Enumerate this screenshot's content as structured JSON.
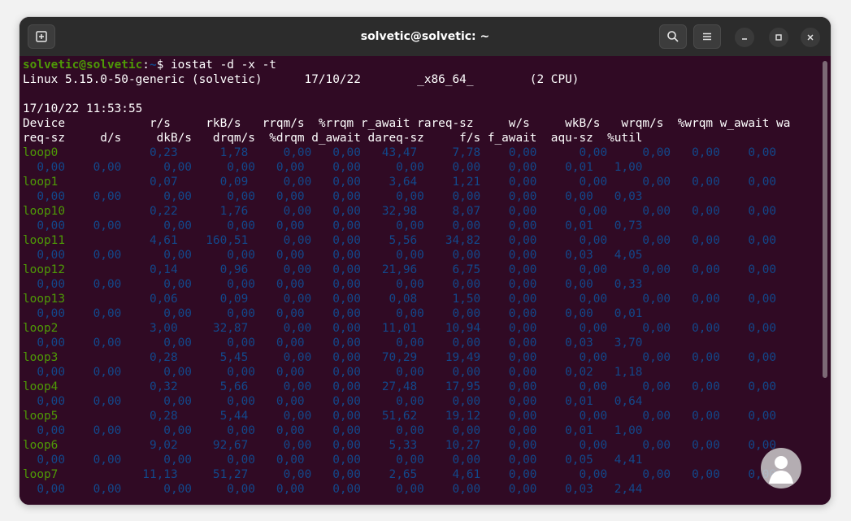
{
  "window": {
    "title": "solvetic@solvetic: ~"
  },
  "titlebar": {
    "new_tab_icon": "new-tab-icon",
    "search_icon": "search-icon",
    "menu_icon": "hamburger-menu-icon",
    "minimize_icon": "minimize-icon",
    "maximize_icon": "maximize-icon",
    "close_icon": "close-icon"
  },
  "colors": {
    "prompt_green": "#4e9a06",
    "value_blue": "#12488b",
    "text_white": "#ffffff",
    "background": "#300a24"
  },
  "terminal": {
    "prompt": {
      "user_host": "solvetic@solvetic",
      "sep": ":",
      "path": "~",
      "symbol": "$",
      "command": " iostat -d -x -t"
    },
    "sysinfo": "Linux 5.15.0-50-generic (solvetic)      17/10/22        _x86_64_        (2 CPU)",
    "timestamp": "17/10/22 11:53:55",
    "header1": "Device            r/s     rkB/s   rrqm/s  %rrqm r_await rareq-sz     w/s     wkB/s   wrqm/s  %wrqm w_await wa",
    "header2": "req-sz     d/s     dkB/s   drqm/s  %drqm d_await dareq-sz     f/s f_await  aqu-sz  %util",
    "devices": [
      {
        "name": "loop0",
        "row1": "             0,23      1,78     0,00   0,00   43,47     7,78    0,00      0,00     0,00   0,00    0,00",
        "row2": "  0,00    0,00      0,00     0,00   0,00    0,00     0,00    0,00    0,00    0,01   1,00"
      },
      {
        "name": "loop1",
        "row1": "             0,07      0,09     0,00   0,00    3,64     1,21    0,00      0,00     0,00   0,00    0,00",
        "row2": "  0,00    0,00      0,00     0,00   0,00    0,00     0,00    0,00    0,00    0,00   0,03"
      },
      {
        "name": "loop10",
        "row1": "            0,22      1,76     0,00   0,00   32,98     8,07    0,00      0,00     0,00   0,00    0,00",
        "row2": "  0,00    0,00      0,00     0,00   0,00    0,00     0,00    0,00    0,00    0,01   0,73"
      },
      {
        "name": "loop11",
        "row1": "            4,61    160,51     0,00   0,00    5,56    34,82    0,00      0,00     0,00   0,00    0,00",
        "row2": "  0,00    0,00      0,00     0,00   0,00    0,00     0,00    0,00    0,00    0,03   4,05"
      },
      {
        "name": "loop12",
        "row1": "            0,14      0,96     0,00   0,00   21,96     6,75    0,00      0,00     0,00   0,00    0,00",
        "row2": "  0,00    0,00      0,00     0,00   0,00    0,00     0,00    0,00    0,00    0,00   0,33"
      },
      {
        "name": "loop13",
        "row1": "            0,06      0,09     0,00   0,00    0,08     1,50    0,00      0,00     0,00   0,00    0,00",
        "row2": "  0,00    0,00      0,00     0,00   0,00    0,00     0,00    0,00    0,00    0,00   0,01"
      },
      {
        "name": "loop2",
        "row1": "             3,00     32,87     0,00   0,00   11,01    10,94    0,00      0,00     0,00   0,00    0,00",
        "row2": "  0,00    0,00      0,00     0,00   0,00    0,00     0,00    0,00    0,00    0,03   3,70"
      },
      {
        "name": "loop3",
        "row1": "             0,28      5,45     0,00   0,00   70,29    19,49    0,00      0,00     0,00   0,00    0,00",
        "row2": "  0,00    0,00      0,00     0,00   0,00    0,00     0,00    0,00    0,00    0,02   1,18"
      },
      {
        "name": "loop4",
        "row1": "             0,32      5,66     0,00   0,00   27,48    17,95    0,00      0,00     0,00   0,00    0,00",
        "row2": "  0,00    0,00      0,00     0,00   0,00    0,00     0,00    0,00    0,00    0,01   0,64"
      },
      {
        "name": "loop5",
        "row1": "             0,28      5,44     0,00   0,00   51,62    19,12    0,00      0,00     0,00   0,00    0,00",
        "row2": "  0,00    0,00      0,00     0,00   0,00    0,00     0,00    0,00    0,00    0,01   1,00"
      },
      {
        "name": "loop6",
        "row1": "             9,02     92,67     0,00   0,00    5,33    10,27    0,00      0,00     0,00   0,00    0,00",
        "row2": "  0,00    0,00      0,00     0,00   0,00    0,00     0,00    0,00    0,00    0,05   4,41"
      },
      {
        "name": "loop7",
        "row1": "            11,13     51,27     0,00   0,00    2,65     4,61    0,00      0,00     0,00   0,00    0,00",
        "row2": "  0,00    0,00      0,00     0,00   0,00    0,00     0,00    0,00    0,00    0,03   2,44"
      }
    ]
  }
}
